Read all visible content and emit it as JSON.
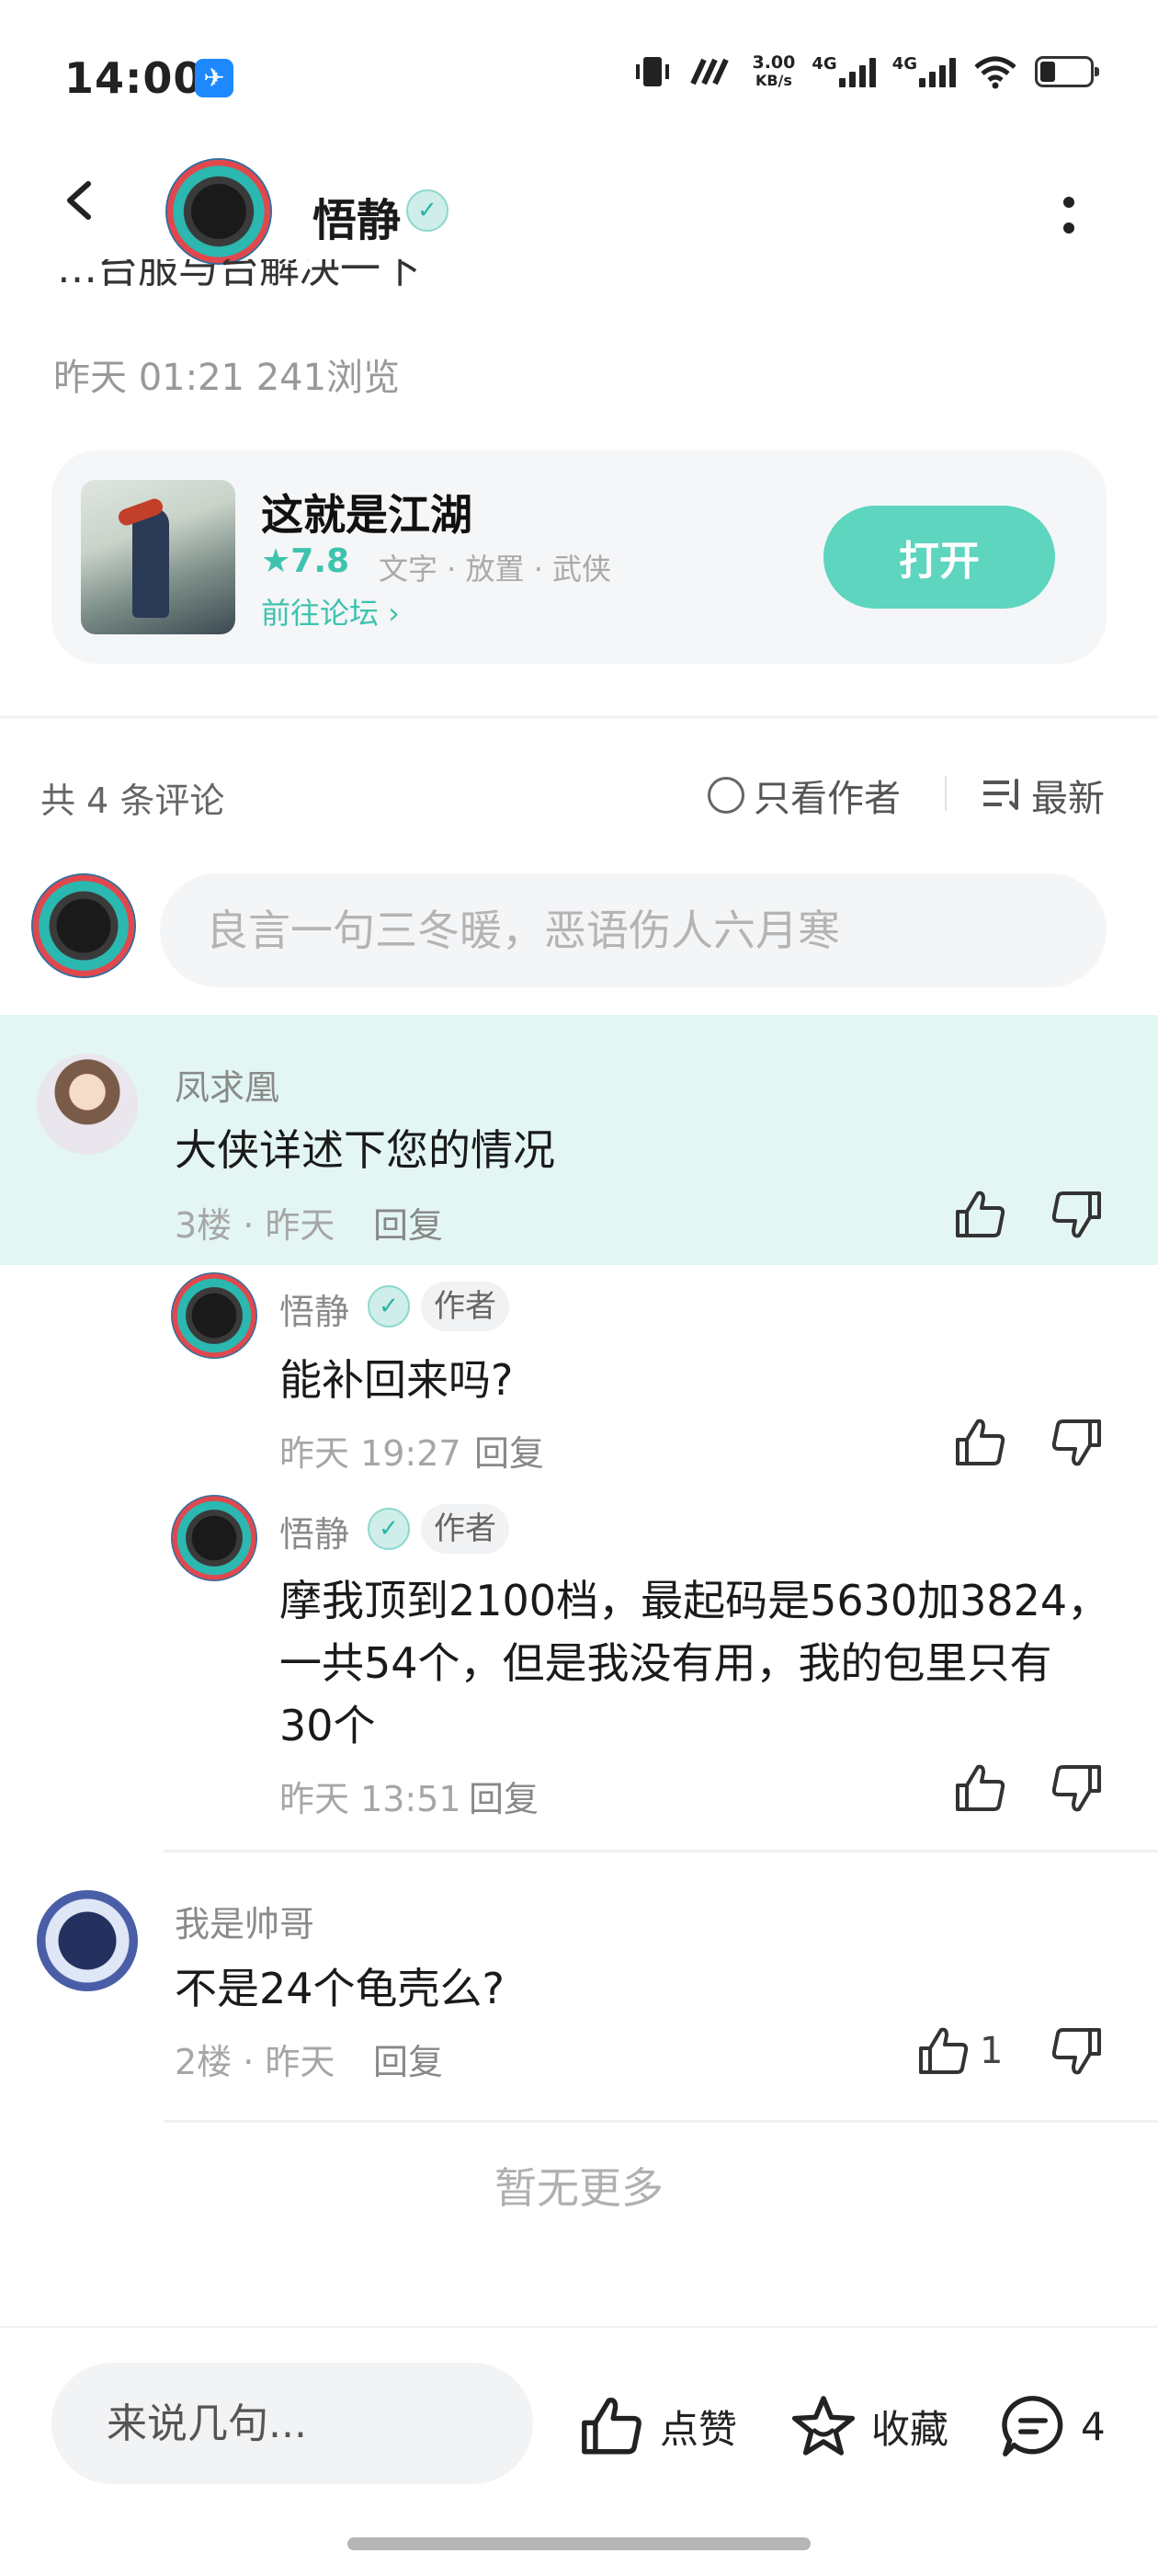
{
  "status_bar": {
    "time": "14:00",
    "app_badge": "✈",
    "net_speed_value": "3.00",
    "net_speed_unit": "KB/s",
    "network_1": "4G",
    "network_2": "4G"
  },
  "header": {
    "author_name": "悟静",
    "verified_badge": "✓"
  },
  "post": {
    "meta": "昨天 01:21  241浏览",
    "cut_text": "…台服与台解决一下"
  },
  "game_card": {
    "title": "这就是江湖",
    "rating": "★7.8",
    "tags": "文字 · 放置 · 武侠",
    "forum_link": "前往论坛 ›",
    "open_button": "打开"
  },
  "comments_header": {
    "count": "共 4 条评论",
    "only_author": "只看作者",
    "sort": "最新"
  },
  "comment_input": {
    "placeholder": "良言一句三冬暖，恶语伤人六月寒"
  },
  "comments": [
    {
      "name": "凤求凰",
      "text": "大侠详述下您的情况",
      "meta": "3楼 · 昨天",
      "reply": "回复",
      "replies": [
        {
          "name": "悟静",
          "badge": "✓",
          "tag": "作者",
          "text": "能补回来吗?",
          "time": "昨天 19:27",
          "reply": "回复"
        },
        {
          "name": "悟静",
          "badge": "✓",
          "tag": "作者",
          "text_line1": "摩我顶到2100档，最起码是5630加3824，",
          "text_line2": "一共54个，但是我没有用，我的包里只有",
          "text_line3": "30个",
          "time": "昨天 13:51",
          "reply": "回复"
        }
      ]
    },
    {
      "name": "我是帅哥",
      "text": "不是24个龟壳么?",
      "meta": "2楼 · 昨天",
      "reply": "回复",
      "likes": "1"
    }
  ],
  "no_more": "暂无更多",
  "bottom_bar": {
    "input_placeholder": "来说几句...",
    "like_label": "点赞",
    "favorite_label": "收藏",
    "comment_count": "4"
  },
  "colors": {
    "accent": "#5dd5bf",
    "accent_text": "#3ec3ae",
    "highlight_band": "#e3f6f3"
  }
}
